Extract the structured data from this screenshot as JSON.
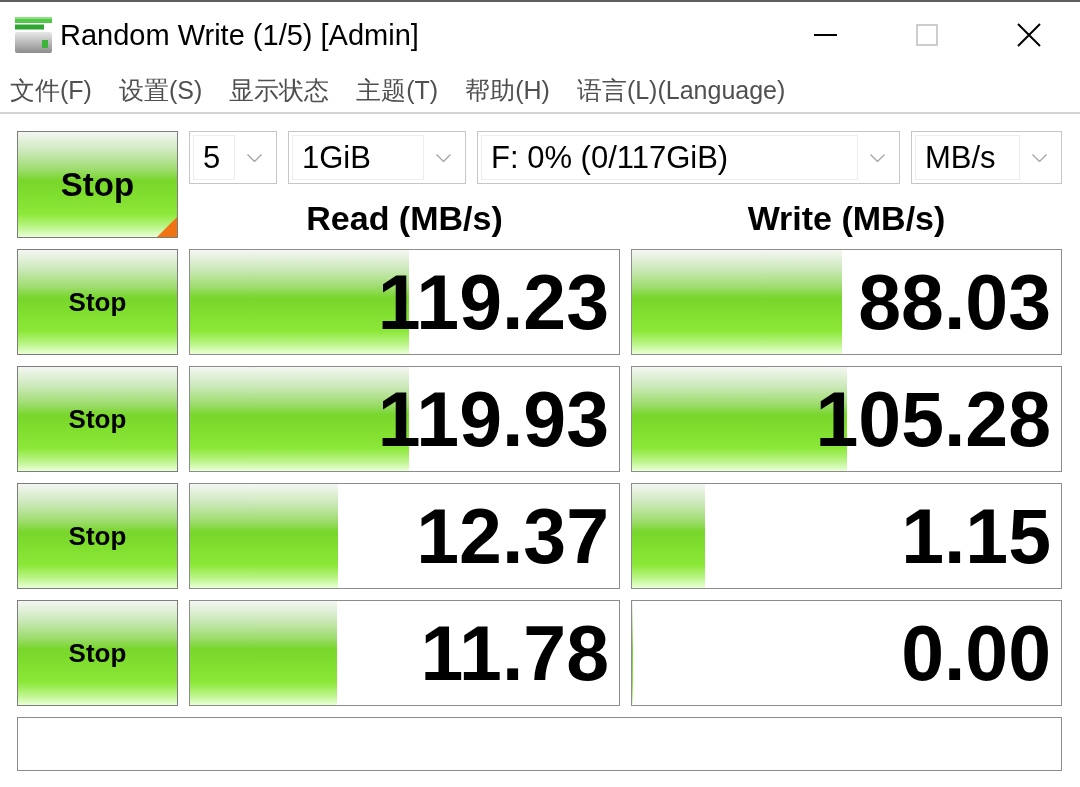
{
  "window": {
    "title": "Random Write (1/5) [Admin]",
    "controls": [
      {
        "kind": "minimize",
        "disabled": false
      },
      {
        "kind": "maximize",
        "disabled": true
      },
      {
        "kind": "close",
        "disabled": false
      }
    ]
  },
  "menu": [
    "文件(F)",
    "设置(S)",
    "显示状态",
    "主题(T)",
    "帮助(H)",
    "语言(L)(Language)"
  ],
  "toolbar": {
    "all_button": "Stop",
    "dropdowns": [
      "5",
      "1GiB",
      "F: 0% (0/117GiB)",
      "MB/s"
    ]
  },
  "columns": [
    "Read (MB/s)",
    "Write (MB/s)"
  ],
  "tests": [
    {
      "button": "Stop",
      "read": {
        "reading": "119.23",
        "level": 0.51
      },
      "write": {
        "reading": "88.03",
        "level": 0.49
      }
    },
    {
      "button": "Stop",
      "read": {
        "reading": "119.93",
        "level": 0.51
      },
      "write": {
        "reading": "105.28",
        "level": 0.5
      }
    },
    {
      "button": "Stop",
      "read": {
        "reading": "12.37",
        "level": 0.345
      },
      "write": {
        "reading": "1.15",
        "level": 0.17
      }
    },
    {
      "button": "Stop",
      "read": {
        "reading": "11.78",
        "level": 0.343
      },
      "write": {
        "reading": "0.00",
        "level": 0
      }
    }
  ]
}
